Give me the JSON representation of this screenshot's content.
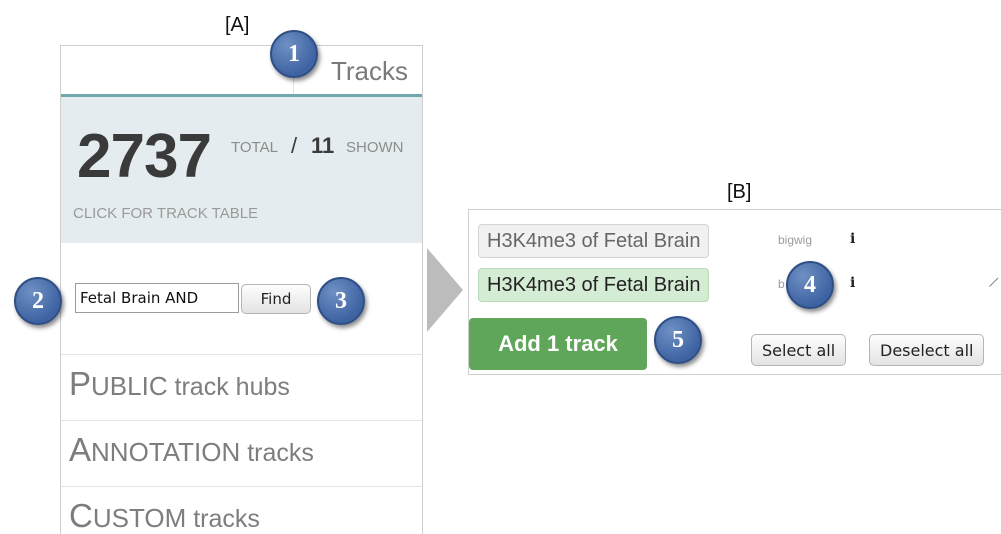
{
  "panel_a": {
    "tag": "[A]",
    "tab_label": "Tracks",
    "stats": {
      "total": "2737",
      "total_label": "TOTAL",
      "slash": "/",
      "shown": "11",
      "shown_label": "SHOWN",
      "click_label": "CLICK FOR TRACK TABLE"
    },
    "search": {
      "value": "Fetal Brain AND",
      "find_label": "Find"
    },
    "sections": [
      {
        "first": "P",
        "rest_caps": "UBLIC",
        "suffix": " track hubs"
      },
      {
        "first": "A",
        "rest_caps": "NNOTATION",
        "suffix": " tracks"
      },
      {
        "first": "C",
        "rest_caps": "USTOM",
        "suffix": " tracks"
      }
    ]
  },
  "panel_b": {
    "tag": "[B]",
    "tracks": [
      {
        "name": "H3K4me3 of Fetal Brain",
        "type": "bigwig",
        "info": "i",
        "state": "unselected"
      },
      {
        "name": "H3K4me3 of Fetal Brain",
        "type": "b",
        "info": "i",
        "state": "selected"
      }
    ],
    "add_label": "Add 1 track",
    "select_all_label": "Select all",
    "deselect_all_label": "Deselect all"
  },
  "callouts": [
    "1",
    "2",
    "3",
    "4",
    "5"
  ],
  "colors": {
    "accent_teal": "#6fa8ad",
    "stats_bg": "#e4ecef",
    "add_button": "#5fa55a",
    "selected_track": "#d5ecd4",
    "callout_blue": "#3e63a2"
  }
}
